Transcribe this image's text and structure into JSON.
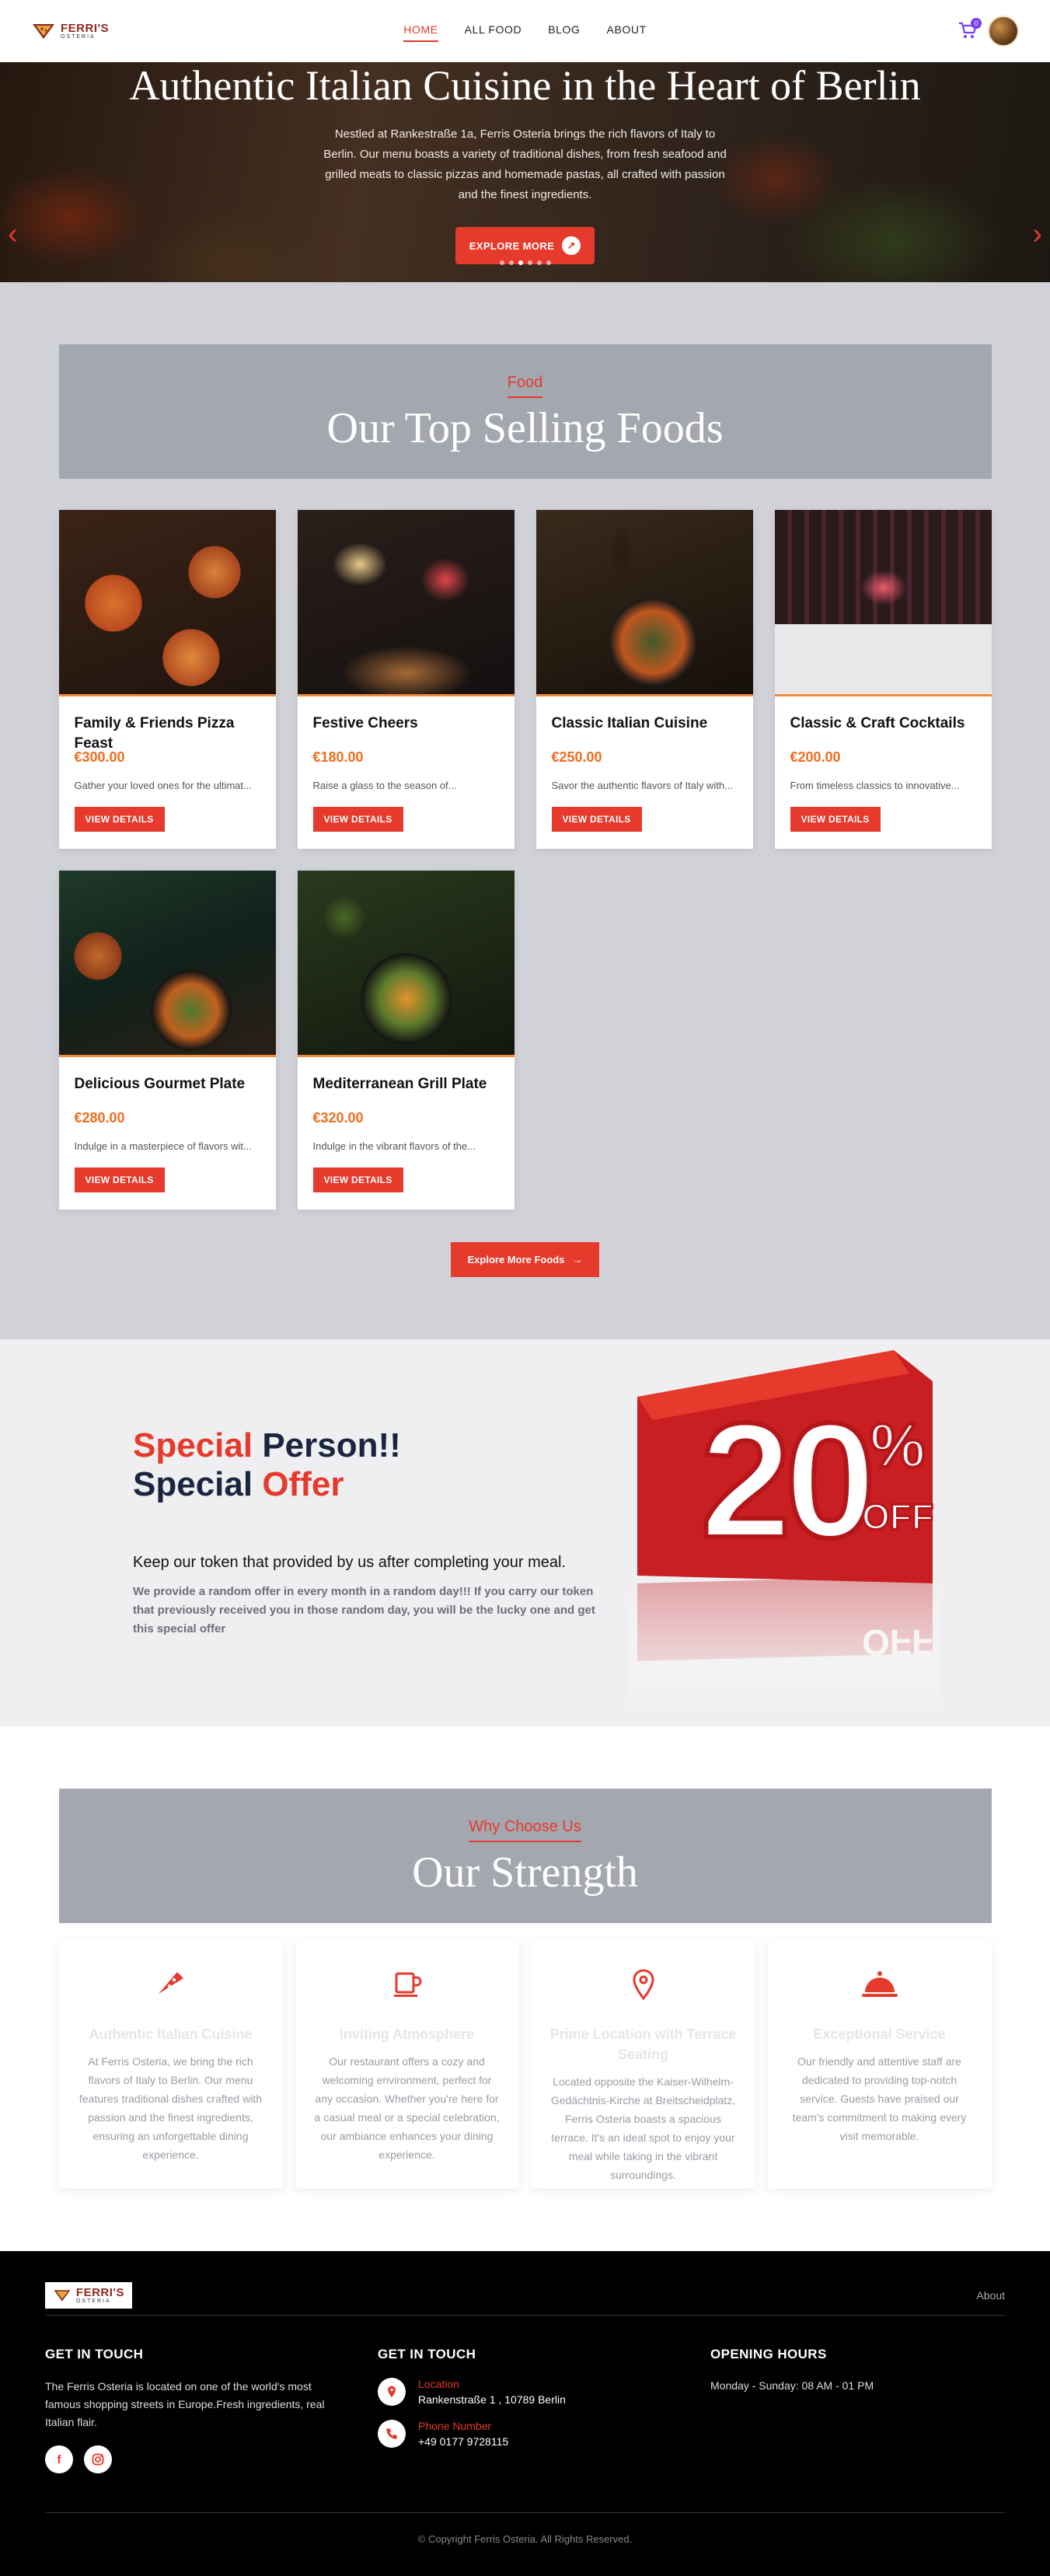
{
  "brand": {
    "name": "FERRI'S",
    "sub": "OSTERIA"
  },
  "nav": {
    "items": [
      {
        "label": "HOME",
        "active": true
      },
      {
        "label": "ALL FOOD"
      },
      {
        "label": "BLOG"
      },
      {
        "label": "ABOUT"
      }
    ],
    "cart_count": "0"
  },
  "hero": {
    "title": "Authentic Italian Cuisine in the Heart of Berlin",
    "description": "Nestled at Rankestraße 1a, Ferris Osteria brings the rich flavors of Italy to Berlin. Our menu boasts a variety of traditional dishes, from fresh seafood and grilled meats to classic pizzas and homemade pastas, all crafted with passion and the finest ingredients.",
    "button": "EXPLORE MORE",
    "slides": 6,
    "active_slide": 2
  },
  "foods": {
    "tag": "Food",
    "title": "Our Top Selling Foods",
    "items": [
      {
        "name": "Family & Friends Pizza Feast",
        "price": "€300.00",
        "desc": "Gather your loved ones for the ultimat...",
        "button": "VIEW DETAILS"
      },
      {
        "name": "Festive Cheers",
        "price": "€180.00",
        "desc": "Raise a glass to the season of...",
        "button": "VIEW DETAILS"
      },
      {
        "name": "Classic Italian Cuisine",
        "price": "€250.00",
        "desc": "Savor the authentic flavors of Italy with...",
        "button": "VIEW DETAILS"
      },
      {
        "name": "Classic & Craft Cocktails",
        "price": "€200.00",
        "desc": "From timeless classics to innovative...",
        "button": "VIEW DETAILS"
      },
      {
        "name": "Delicious Gourmet Plate",
        "price": "€280.00",
        "desc": "Indulge in a masterpiece of flavors wit...",
        "button": "VIEW DETAILS"
      },
      {
        "name": "Mediterranean Grill Plate",
        "price": "€320.00",
        "desc": "Indulge in the vibrant flavors of the...",
        "button": "VIEW DETAILS"
      }
    ],
    "more_button": "Explore More Foods"
  },
  "special": {
    "line1_a": "Special",
    "line1_b": " Person!!",
    "line2_a": "Special ",
    "line2_b": "Offer",
    "lead": "Keep our token that provided by us after completing your meal.",
    "note": "We provide a random offer in every month in a random day!!! If you carry our token that previously received you in those random day, you will be the lucky one and get this special offer",
    "badge_number": "20",
    "badge_percent": "%",
    "badge_off": "OFF"
  },
  "strength": {
    "tag": "Why Choose Us",
    "title": "Our Strength",
    "features": [
      {
        "icon": "pizza-icon",
        "title": "Authentic Italian Cuisine",
        "text": "At Ferris Osteria, we bring the rich flavors of Italy to Berlin. Our menu features traditional dishes crafted with passion and the finest ingredients, ensuring an unforgettable dining experience."
      },
      {
        "icon": "coffee-cup-icon",
        "title": "Inviting Atmosphere",
        "text": "Our restaurant offers a cozy and welcoming environment, perfect for any occasion. Whether you're here for a casual meal or a special celebration, our ambiance enhances your dining experience."
      },
      {
        "icon": "location-pin-icon",
        "title": "Prime Location with Terrace Seating",
        "text": "Located opposite the Kaiser-Wilhelm-Gedächtnis-Kirche at Breitscheidplatz, Ferris Osteria boasts a spacious terrace. It's an ideal spot to enjoy your meal while taking in the vibrant surroundings."
      },
      {
        "icon": "cloche-icon",
        "title": "Exceptional Service",
        "text": "Our friendly and attentive staff are dedicated to providing top-notch service. Guests have praised our team's commitment to making every visit memorable."
      }
    ]
  },
  "footer": {
    "about_link": "About",
    "col1": {
      "heading": "GET IN TOUCH",
      "text": "The Ferris Osteria is located on one of the world's most famous shopping streets in Europe.Fresh ingredients, real Italian flair."
    },
    "col2": {
      "heading": "GET IN TOUCH",
      "location_label": "Location",
      "location_value": "Rankenstraße 1 , 10789 Berlin",
      "phone_label": "Phone Number",
      "phone_value": "+49 0177 9728115"
    },
    "col3": {
      "heading": "OPENING HOURS",
      "text": "Monday - Sunday: 08 AM - 01 PM"
    },
    "copyright": "© Copyright Ferris Osteria. All Rights Reserved."
  },
  "colors": {
    "accent": "#e53a2c",
    "price": "#f06d1d",
    "navy": "#1b2540",
    "section_gray": "#d0d2d8",
    "header_gray": "#a4a7af"
  }
}
